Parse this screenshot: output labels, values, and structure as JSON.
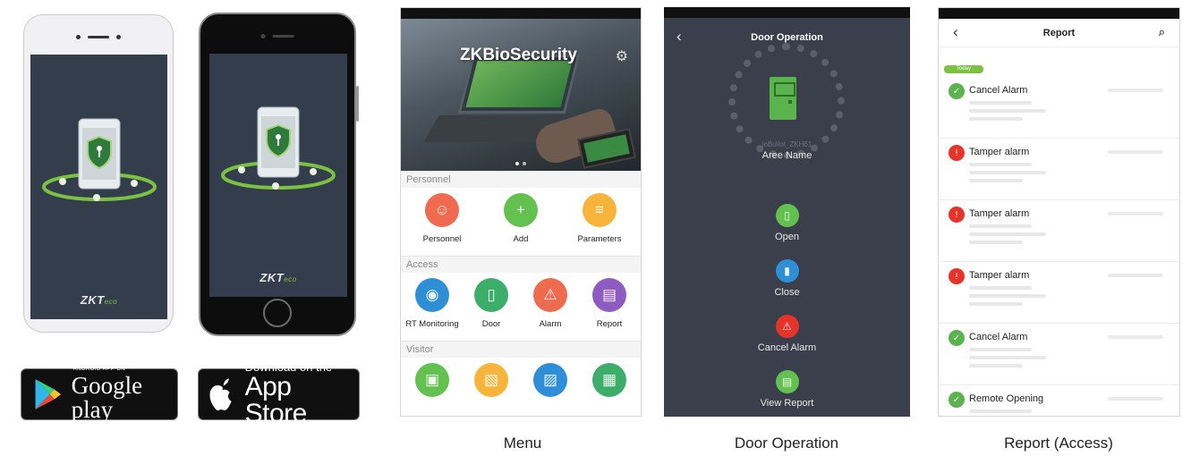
{
  "splash": {
    "brand_logo": "ZKTeco",
    "brand_logo_main": "ZKT",
    "brand_logo_suffix": "eco",
    "icon": "shield-keyhole-icon"
  },
  "badges": {
    "google_play": {
      "small": "ANDROID APP ON",
      "big": "Google play",
      "icon": "google-play-triangle-icon"
    },
    "app_store": {
      "small": "Download on the",
      "big": "App Store",
      "icon": "apple-icon"
    }
  },
  "menu_screen": {
    "title": "ZKBioSecurity",
    "sections": [
      {
        "title": "Personnel",
        "items": [
          {
            "label": "Personnel",
            "color": "#ef6b4f",
            "icon": "person-icon",
            "glyph": "☺"
          },
          {
            "label": "Add",
            "color": "#62c14f",
            "icon": "add-person-icon",
            "glyph": "+"
          },
          {
            "label": "Parameters",
            "color": "#f7b43a",
            "icon": "parameters-icon",
            "glyph": "≡"
          }
        ]
      },
      {
        "title": "Access",
        "items": [
          {
            "label": "RT Monitoring",
            "color": "#2f8fd6",
            "icon": "rt-monitoring-icon",
            "glyph": "◉"
          },
          {
            "label": "Door",
            "color": "#3cae6a",
            "icon": "door-icon",
            "glyph": "▯"
          },
          {
            "label": "Alarm",
            "color": "#ef6b4f",
            "icon": "alarm-icon",
            "glyph": "⚠"
          },
          {
            "label": "Report",
            "color": "#8e5cc1",
            "icon": "report-icon",
            "glyph": "▤"
          }
        ]
      },
      {
        "title": "Visitor",
        "items": [
          {
            "label": "",
            "color": "#62c14f",
            "icon": "visitor-registration-icon",
            "glyph": "▣"
          },
          {
            "label": "",
            "color": "#f7b43a",
            "icon": "visitor-add-icon",
            "glyph": "▧"
          },
          {
            "label": "",
            "color": "#2f8fd6",
            "icon": "visitor-photo-icon",
            "glyph": "▨"
          },
          {
            "label": "",
            "color": "#3cae6a",
            "icon": "visitor-report-icon",
            "glyph": "▦"
          }
        ]
      }
    ]
  },
  "door_screen": {
    "title": "Door Operation",
    "device_id": "inBuilot_ZKH61",
    "area_name": "Aree Name",
    "actions": [
      {
        "label": "Open",
        "color": "#62c14f",
        "icon": "door-open-icon",
        "glyph": "▯"
      },
      {
        "label": "Close",
        "color": "#2f8fd6",
        "icon": "door-close-icon",
        "glyph": "▮"
      },
      {
        "label": "Cancel Alarm",
        "color": "#e8332a",
        "icon": "cancel-alarm-icon",
        "glyph": "⚠"
      },
      {
        "label": "View Report",
        "color": "#62c14f",
        "icon": "view-report-icon",
        "glyph": "▤"
      }
    ]
  },
  "report_screen": {
    "title": "Report",
    "today_tag": "Today",
    "items": [
      {
        "event": "Cancel Alarm",
        "status": "success",
        "color": "#5ab34d",
        "glyph": "✓"
      },
      {
        "event": "Tamper alarm",
        "status": "alarm",
        "color": "#e8332a",
        "glyph": "!"
      },
      {
        "event": "Tamper alarm",
        "status": "alarm",
        "color": "#e8332a",
        "glyph": "!"
      },
      {
        "event": "Tamper alarm",
        "status": "alarm",
        "color": "#e8332a",
        "glyph": "!"
      },
      {
        "event": "Cancel Alarm",
        "status": "success",
        "color": "#5ab34d",
        "glyph": "✓"
      },
      {
        "event": "Remote Opening",
        "status": "success",
        "color": "#5ab34d",
        "glyph": "✓"
      }
    ]
  },
  "captions": {
    "menu": "Menu",
    "door": "Door Operation",
    "report": "Report (Access)"
  }
}
